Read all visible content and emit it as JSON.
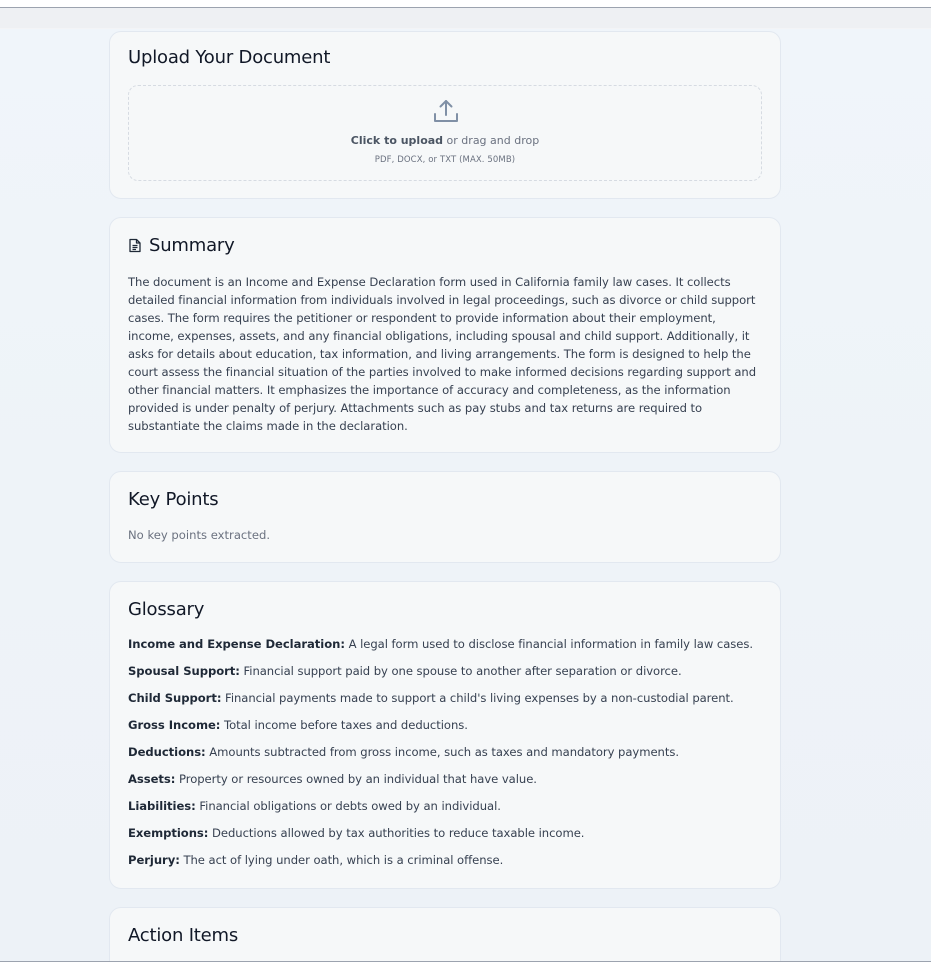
{
  "upload": {
    "title": "Upload Your Document",
    "click_label": "Click to upload",
    "drag_label": " or drag and drop",
    "hint": "PDF, DOCX, or TXT (MAX. 50MB)"
  },
  "summary": {
    "title": "Summary",
    "text": "The document is an Income and Expense Declaration form used in California family law cases. It collects detailed financial information from individuals involved in legal proceedings, such as divorce or child support cases. The form requires the petitioner or respondent to provide information about their employment, income, expenses, assets, and any financial obligations, including spousal and child support. Additionally, it asks for details about education, tax information, and living arrangements. The form is designed to help the court assess the financial situation of the parties involved to make informed decisions regarding support and other financial matters. It emphasizes the importance of accuracy and completeness, as the information provided is under penalty of perjury. Attachments such as pay stubs and tax returns are required to substantiate the claims made in the declaration."
  },
  "key_points": {
    "title": "Key Points",
    "empty_text": "No key points extracted."
  },
  "glossary": {
    "title": "Glossary",
    "items": [
      {
        "term": "Income and Expense Declaration:",
        "definition": " A legal form used to disclose financial information in family law cases."
      },
      {
        "term": "Spousal Support:",
        "definition": " Financial support paid by one spouse to another after separation or divorce."
      },
      {
        "term": "Child Support:",
        "definition": " Financial payments made to support a child's living expenses by a non-custodial parent."
      },
      {
        "term": "Gross Income:",
        "definition": " Total income before taxes and deductions."
      },
      {
        "term": "Deductions:",
        "definition": " Amounts subtracted from gross income, such as taxes and mandatory payments."
      },
      {
        "term": "Assets:",
        "definition": " Property or resources owned by an individual that have value."
      },
      {
        "term": "Liabilities:",
        "definition": " Financial obligations or debts owed by an individual."
      },
      {
        "term": "Exemptions:",
        "definition": " Deductions allowed by tax authorities to reduce taxable income."
      },
      {
        "term": "Perjury:",
        "definition": " The act of lying under oath, which is a criminal offense."
      }
    ]
  },
  "action_items": {
    "title": "Action Items"
  },
  "icons": {
    "upload": "upload-icon",
    "summary": "document-icon"
  },
  "colors": {
    "card_background": "#f6f8f9",
    "page_background": "#eef3f8",
    "border": "#e2e8f0",
    "muted_text": "#6b7280"
  }
}
